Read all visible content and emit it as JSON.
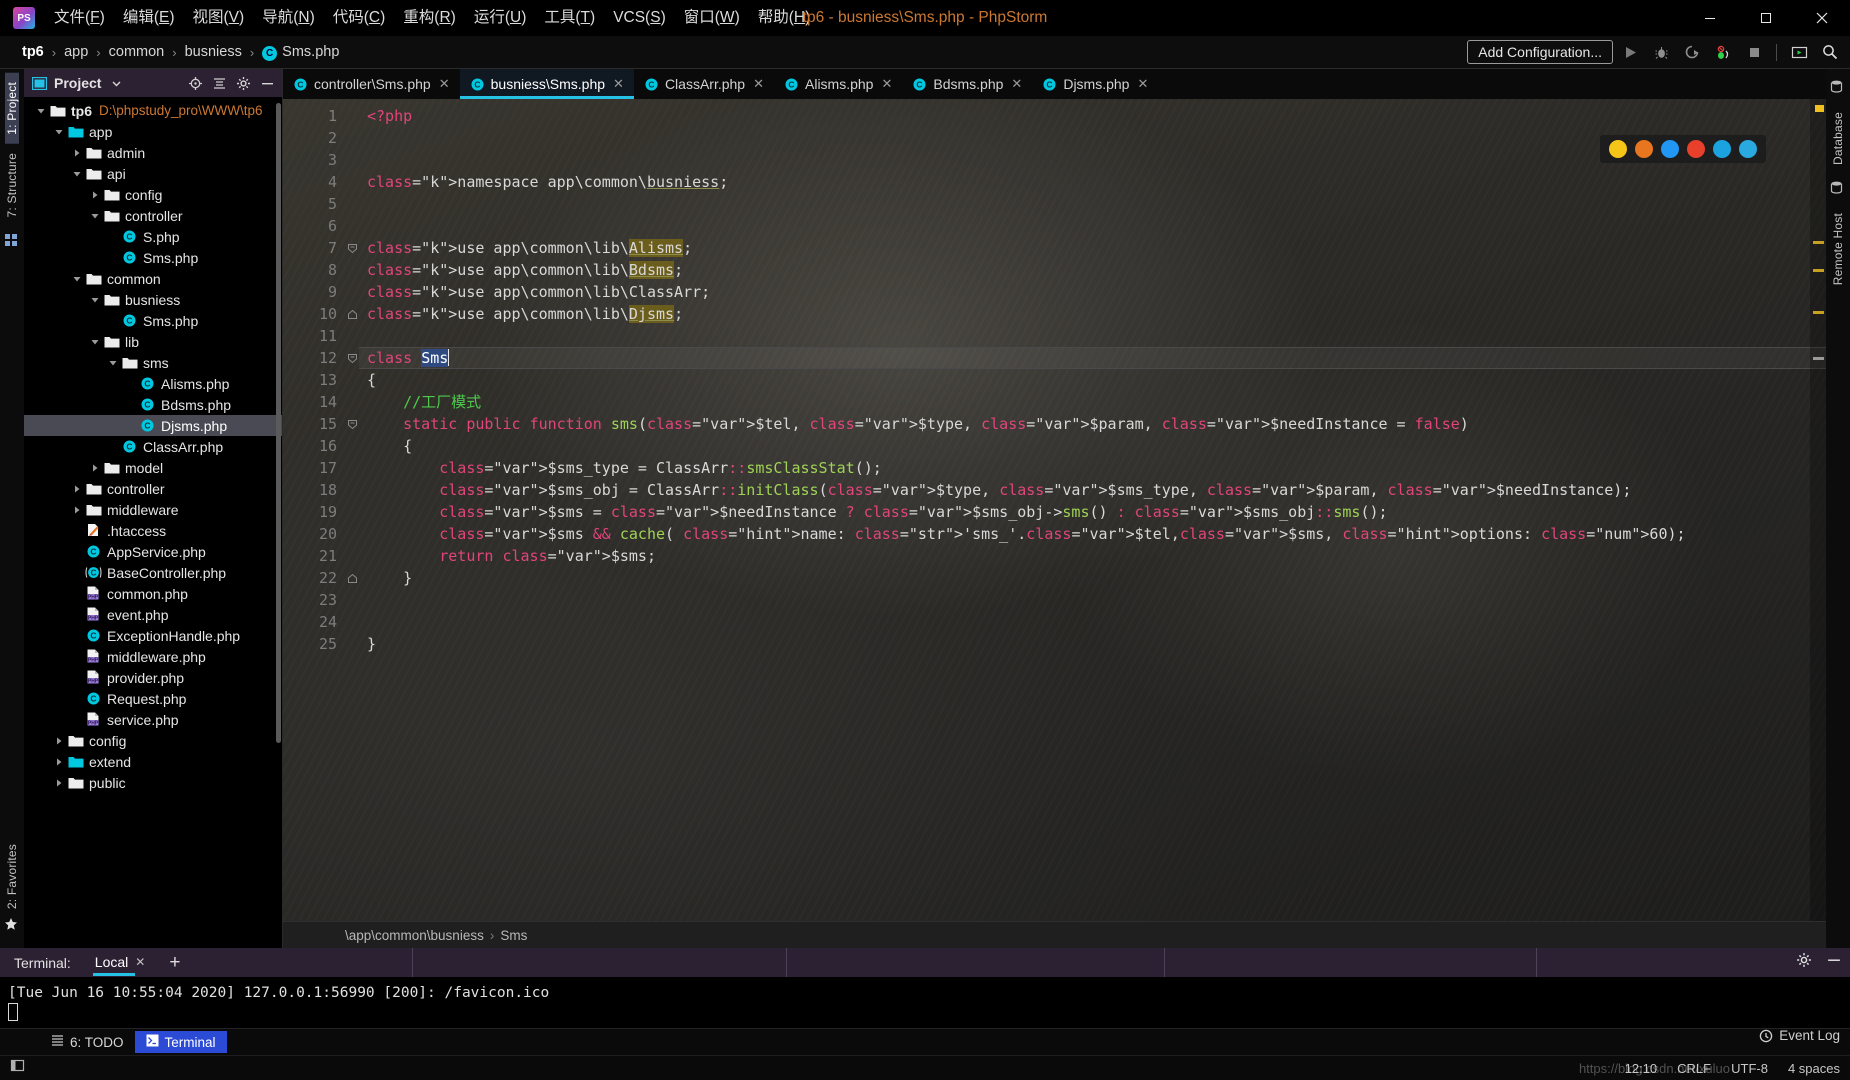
{
  "window": {
    "title": "tp6 - busniess\\Sms.php - PhpStorm",
    "logo_text": "PS",
    "minimize": "minimize-icon",
    "maximize": "maximize-icon",
    "close": "close-icon"
  },
  "menu": [
    {
      "label": "文件(F)"
    },
    {
      "label": "编辑(E)"
    },
    {
      "label": "视图(V)"
    },
    {
      "label": "导航(N)"
    },
    {
      "label": "代码(C)"
    },
    {
      "label": "重构(R)"
    },
    {
      "label": "运行(U)"
    },
    {
      "label": "工具(T)"
    },
    {
      "label": "VCS(S)"
    },
    {
      "label": "窗口(W)"
    },
    {
      "label": "帮助(H)"
    }
  ],
  "breadcrumb": {
    "items": [
      "tp6",
      "app",
      "common",
      "busniess",
      "Sms.php"
    ],
    "separator": "›"
  },
  "toolbar": {
    "add_configuration": "Add Configuration...",
    "run": "run-icon",
    "debug": "debug-icon",
    "coverage": "run-with-coverage-icon",
    "profile": "profile-icon",
    "stop": "stop-icon",
    "browser_run": "run-in-browser-icon",
    "search": "search-everywhere-icon"
  },
  "left_strip": [
    {
      "label": "1: Project",
      "selected": true
    },
    {
      "label": "7: Structure",
      "selected": false
    }
  ],
  "left_strip_bottom": [
    {
      "label": "2: Favorites",
      "selected": false
    }
  ],
  "right_strip": [
    {
      "label": "Database",
      "selected": false
    },
    {
      "label": "Remote Host",
      "selected": false
    }
  ],
  "project": {
    "title": "Project",
    "icons": [
      "project-dropdown-icon",
      "locate-icon",
      "collapse-all-icon",
      "gear-icon",
      "hide-icon"
    ],
    "tree": [
      {
        "indent": 0,
        "twist": "down",
        "icon": "folder",
        "label": "tp6",
        "bold": true,
        "path": "D:\\phpstudy_pro\\WWW\\tp6",
        "selected": false
      },
      {
        "indent": 1,
        "twist": "down",
        "icon": "folder-src",
        "label": "app",
        "selected": false
      },
      {
        "indent": 2,
        "twist": "right",
        "icon": "folder",
        "label": "admin",
        "selected": false
      },
      {
        "indent": 2,
        "twist": "down",
        "icon": "folder",
        "label": "api",
        "selected": false
      },
      {
        "indent": 3,
        "twist": "right",
        "icon": "folder",
        "label": "config",
        "selected": false
      },
      {
        "indent": 3,
        "twist": "down",
        "icon": "folder",
        "label": "controller",
        "selected": false
      },
      {
        "indent": 4,
        "twist": "none",
        "icon": "class",
        "label": "S.php",
        "selected": false
      },
      {
        "indent": 4,
        "twist": "none",
        "icon": "class",
        "label": "Sms.php",
        "selected": false
      },
      {
        "indent": 2,
        "twist": "down",
        "icon": "folder",
        "label": "common",
        "selected": false
      },
      {
        "indent": 3,
        "twist": "down",
        "icon": "folder",
        "label": "busniess",
        "selected": false
      },
      {
        "indent": 4,
        "twist": "none",
        "icon": "class",
        "label": "Sms.php",
        "selected": false
      },
      {
        "indent": 3,
        "twist": "down",
        "icon": "folder",
        "label": "lib",
        "selected": false
      },
      {
        "indent": 4,
        "twist": "down",
        "icon": "folder",
        "label": "sms",
        "selected": false
      },
      {
        "indent": 5,
        "twist": "none",
        "icon": "class",
        "label": "Alisms.php",
        "selected": false
      },
      {
        "indent": 5,
        "twist": "none",
        "icon": "class",
        "label": "Bdsms.php",
        "selected": false
      },
      {
        "indent": 5,
        "twist": "none",
        "icon": "class",
        "label": "Djsms.php",
        "selected": true
      },
      {
        "indent": 4,
        "twist": "none",
        "icon": "class",
        "label": "ClassArr.php",
        "selected": false
      },
      {
        "indent": 3,
        "twist": "right",
        "icon": "folder",
        "label": "model",
        "selected": false
      },
      {
        "indent": 2,
        "twist": "right",
        "icon": "folder",
        "label": "controller",
        "selected": false
      },
      {
        "indent": 2,
        "twist": "right",
        "icon": "folder",
        "label": "middleware",
        "selected": false
      },
      {
        "indent": 2,
        "twist": "none",
        "icon": "htaccess",
        "label": ".htaccess",
        "selected": false
      },
      {
        "indent": 2,
        "twist": "none",
        "icon": "class",
        "label": "AppService.php",
        "selected": false
      },
      {
        "indent": 2,
        "twist": "none",
        "icon": "abstract-class",
        "label": "BaseController.php",
        "selected": false
      },
      {
        "indent": 2,
        "twist": "none",
        "icon": "php",
        "label": "common.php",
        "selected": false
      },
      {
        "indent": 2,
        "twist": "none",
        "icon": "php",
        "label": "event.php",
        "selected": false
      },
      {
        "indent": 2,
        "twist": "none",
        "icon": "class",
        "label": "ExceptionHandle.php",
        "selected": false
      },
      {
        "indent": 2,
        "twist": "none",
        "icon": "php",
        "label": "middleware.php",
        "selected": false
      },
      {
        "indent": 2,
        "twist": "none",
        "icon": "php",
        "label": "provider.php",
        "selected": false
      },
      {
        "indent": 2,
        "twist": "none",
        "icon": "class",
        "label": "Request.php",
        "selected": false
      },
      {
        "indent": 2,
        "twist": "none",
        "icon": "php",
        "label": "service.php",
        "selected": false
      },
      {
        "indent": 1,
        "twist": "right",
        "icon": "folder",
        "label": "config",
        "selected": false
      },
      {
        "indent": 1,
        "twist": "right",
        "icon": "folder-src",
        "label": "extend",
        "selected": false
      },
      {
        "indent": 1,
        "twist": "right",
        "icon": "folder",
        "label": "public",
        "selected": false
      }
    ]
  },
  "editor": {
    "tabs": [
      {
        "label": "controller\\Sms.php",
        "active": false,
        "icon": "class-icon"
      },
      {
        "label": "busniess\\Sms.php",
        "active": true,
        "icon": "class-icon"
      },
      {
        "label": "ClassArr.php",
        "active": false,
        "icon": "class-icon"
      },
      {
        "label": "Alisms.php",
        "active": false,
        "icon": "class-icon"
      },
      {
        "label": "Bdsms.php",
        "active": false,
        "icon": "class-icon"
      },
      {
        "label": "Djsms.php",
        "active": false,
        "icon": "class-icon"
      }
    ],
    "close_glyph": "✕",
    "line_numbers": [
      1,
      2,
      3,
      4,
      5,
      6,
      7,
      8,
      9,
      10,
      11,
      12,
      13,
      14,
      15,
      16,
      17,
      18,
      19,
      20,
      21,
      22,
      23,
      24,
      25
    ],
    "current_line": 12,
    "breadcrumb_bottom": [
      "\\app\\common\\busniess",
      "Sms"
    ],
    "breadcrumb_bottom_sep": "›",
    "browser_popup": [
      "chrome-icon",
      "firefox-icon",
      "safari-icon",
      "opera-icon",
      "edge-legacy-icon",
      "edge-icon"
    ]
  },
  "code": {
    "lines": [
      "<?php",
      "",
      "",
      "namespace app\\common\\busniess;",
      "",
      "",
      "use app\\common\\lib\\Alisms;",
      "use app\\common\\lib\\Bdsms;",
      "use app\\common\\lib\\ClassArr;",
      "use app\\common\\lib\\Djsms;",
      "",
      "class Sms",
      "{",
      "    //工厂模式",
      "    static public function sms($tel, $type, $param, $needInstance = false)",
      "    {",
      "        $sms_type = ClassArr::smsClassStat();",
      "        $sms_obj = ClassArr::initClass($type, $sms_type, $param, $needInstance);",
      "        $sms = $needInstance ? $sms_obj->sms() : $sms_obj::sms();",
      "        $sms && cache( name: 'sms_'.$tel,$sms, options: 60);",
      "        return $sms;",
      "    }",
      "",
      "",
      "}"
    ],
    "param_hints": [
      "name:",
      "options:"
    ]
  },
  "terminal": {
    "label": "Terminal:",
    "tab": "Local",
    "close_glyph": "✕",
    "add_glyph": "+",
    "output": "[Tue Jun 16 10:55:04 2020] 127.0.0.1:56990 [200]: /favicon.ico",
    "settings_icon": "gear-icon",
    "hide_icon": "hide-icon"
  },
  "tool_tabs": [
    {
      "label": "6: TODO",
      "active": false,
      "icon": "todo-icon"
    },
    {
      "label": "Terminal",
      "active": true,
      "icon": "terminal-icon"
    }
  ],
  "status": {
    "event_log": "Event Log",
    "caret": "12:10",
    "line_sep": "CRLF",
    "encoding": "UTF-8",
    "indent": "4 spaces",
    "watermark": "https://blog.csdn.net/xuluo"
  },
  "colors": {
    "accent": "#25c2e6",
    "title": "#cc7832",
    "keyword": "#e0457b",
    "comment": "#4ec94e",
    "variable": "#e8913a",
    "method": "#9fd356",
    "string": "#7fbf5f",
    "panel_head": "#2c2133",
    "selection": "#4a4a55"
  }
}
